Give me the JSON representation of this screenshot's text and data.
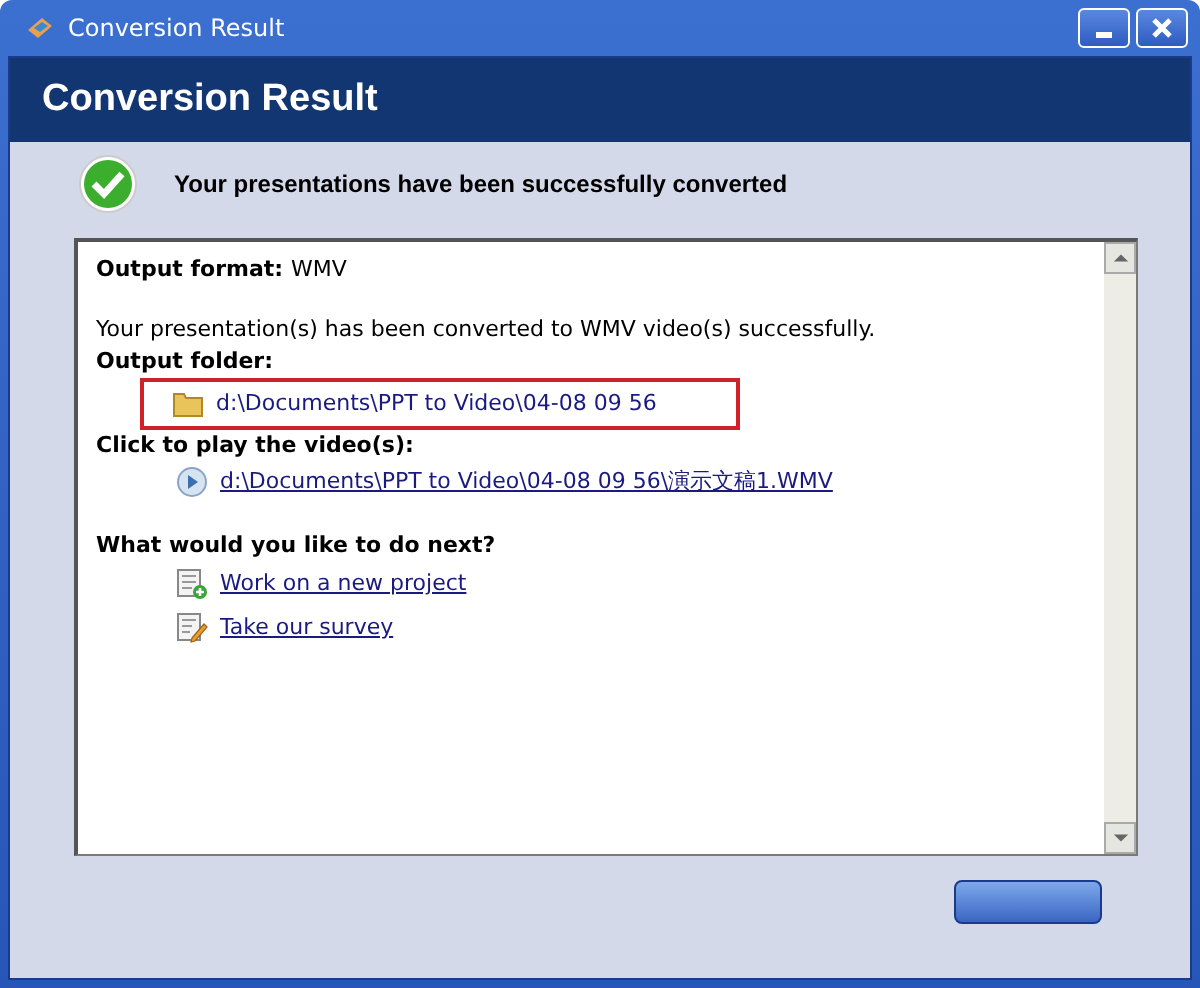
{
  "window": {
    "title": "Conversion Result"
  },
  "header": {
    "title": "Conversion Result"
  },
  "status": {
    "message": "Your presentations have been successfully converted"
  },
  "details": {
    "format_label": "Output format:",
    "format_value": "WMV",
    "summary": "Your presentation(s) has been converted to WMV video(s) successfully.",
    "folder_label": "Output folder:",
    "folder_path": "d:\\Documents\\PPT to Video\\04-08 09 56",
    "folder_highlighted": true,
    "videos_label": "Click to play the video(s):",
    "videos": [
      "d:\\Documents\\PPT to Video\\04-08 09 56\\演示文稿1.WMV"
    ],
    "next_label": "What would you like to do next?",
    "actions": [
      {
        "kind": "new",
        "label": "Work on a new project"
      },
      {
        "kind": "survey",
        "label": "Take our survey"
      }
    ]
  }
}
